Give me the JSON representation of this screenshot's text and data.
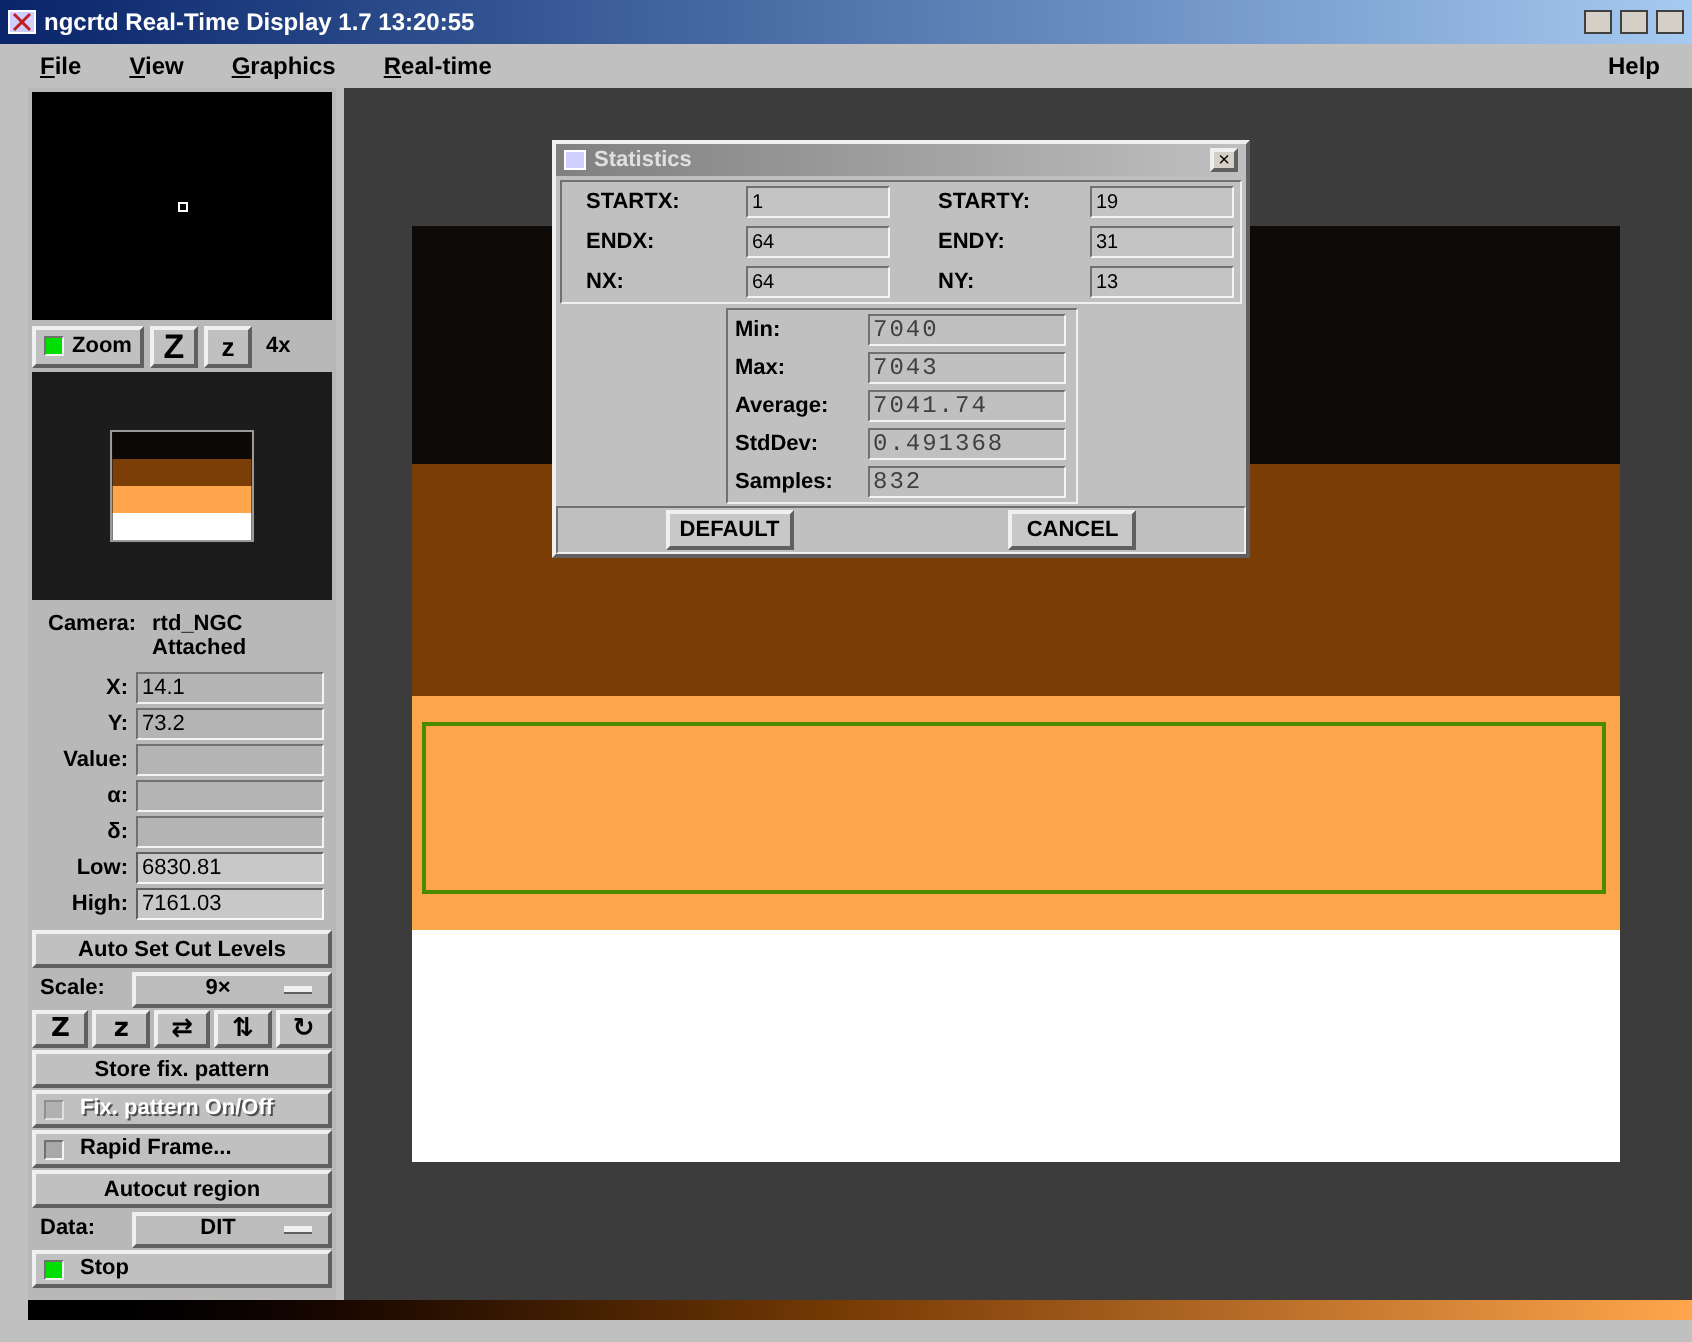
{
  "window": {
    "title": "ngcrtd Real-Time Display 1.7  13:20:55"
  },
  "menu": [
    {
      "label": "File",
      "mnemonic_underlined": true
    },
    {
      "label": "View",
      "mnemonic_underlined": true
    },
    {
      "label": "Graphics",
      "mnemonic_underlined": true
    },
    {
      "label": "Real-time",
      "mnemonic_underlined": true
    }
  ],
  "help_menu": "Help",
  "zoom_bar": {
    "toggle": {
      "label": "Zoom",
      "on": true
    },
    "zoom_in": "Z",
    "zoom_out": "z",
    "factor": "4x"
  },
  "camera": {
    "label": "Camera:",
    "name": "rtd_NGC",
    "status": "Attached"
  },
  "fields": [
    {
      "label": "X:",
      "value": "14.1",
      "editable": false
    },
    {
      "label": "Y:",
      "value": "73.2",
      "editable": false
    },
    {
      "label": "Value:",
      "editable": false
    },
    {
      "label": "α:",
      "editable": false
    },
    {
      "label": "δ:",
      "editable": false
    },
    {
      "label": "Low:",
      "value": "6830.81",
      "editable": true
    },
    {
      "label": "High:",
      "value": "7161.03",
      "editable": true
    }
  ],
  "controls": [
    {
      "kind": "button",
      "label": "Auto Set Cut Levels"
    },
    {
      "kind": "select",
      "label": "Scale:",
      "value": "9×"
    },
    {
      "kind": "tools",
      "items": [
        "Z",
        "z",
        "⇄",
        "⇅",
        "↻"
      ]
    },
    {
      "kind": "button",
      "label": "Store fix. pattern"
    },
    {
      "kind": "toggle",
      "label": "Fix. pattern On/Off",
      "on": false,
      "disabled": true
    },
    {
      "kind": "toggle",
      "label": "Rapid Frame...",
      "on": false,
      "disabled": false
    },
    {
      "kind": "button",
      "label": "Autocut region"
    },
    {
      "kind": "select",
      "label": "Data:",
      "value": "DIT"
    },
    {
      "kind": "toggle",
      "label": "Stop",
      "on": true,
      "disabled": false
    }
  ],
  "statistics": {
    "title": "Statistics",
    "close": "×",
    "region": [
      {
        "label": "STARTX:",
        "value": "1"
      },
      {
        "label": "STARTY:",
        "value": "19"
      },
      {
        "label": "ENDX:",
        "value": "64"
      },
      {
        "label": "ENDY:",
        "value": "31"
      },
      {
        "label": "NX:",
        "value": "64"
      },
      {
        "label": "NY:",
        "value": "13"
      }
    ],
    "results": [
      {
        "label": "Min:",
        "value": "7040"
      },
      {
        "label": "Max:",
        "value": "7043"
      },
      {
        "label": "Average:",
        "value": "7041.74"
      },
      {
        "label": "StdDev:",
        "value": "0.491368"
      },
      {
        "label": "Samples:",
        "value": "832"
      }
    ],
    "buttons": [
      "DEFAULT",
      "CANCEL"
    ]
  }
}
